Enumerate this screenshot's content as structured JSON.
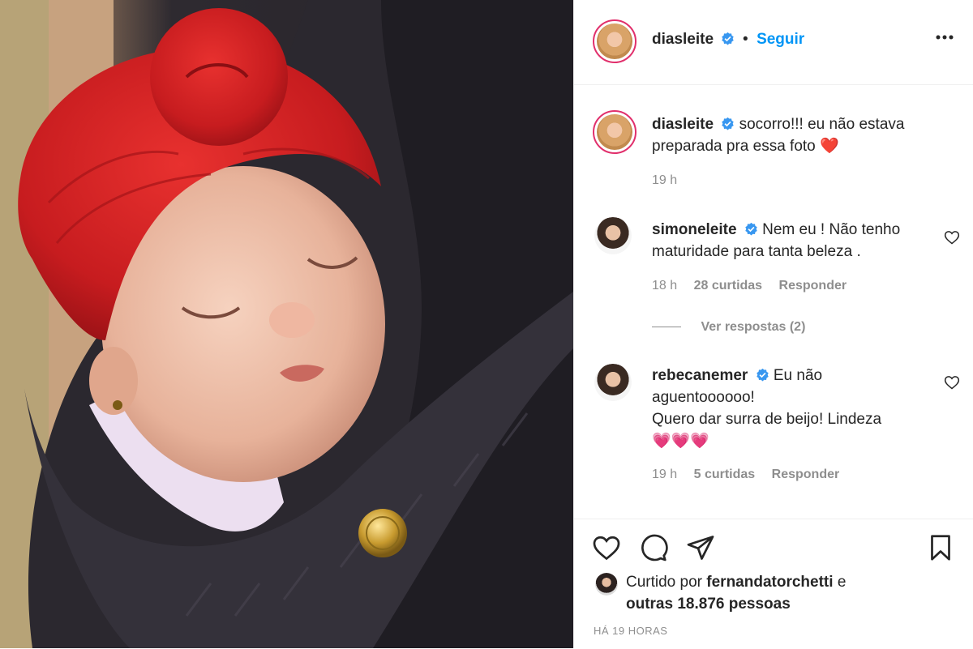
{
  "post": {
    "author": "diasleite",
    "follow_label": "Seguir",
    "dot": "•",
    "caption": "socorro!!! eu não estava preparada pra essa foto",
    "caption_emoji": "❤️",
    "caption_time": "19 h"
  },
  "comments": [
    {
      "user": "simoneleite",
      "text_line1": "Nem eu ! Não tenho",
      "text_line2": "maturidade para tanta beleza .",
      "time": "18 h",
      "likes": "28 curtidas",
      "reply": "Responder",
      "view_replies": "Ver respostas (2)"
    },
    {
      "user": "rebecanemer",
      "text_line1": "Eu não",
      "text_line2": "aguentoooooo!",
      "text_line3": "Quero dar surra de beijo! Lindeza",
      "emojis": "💗💗💗",
      "time": "19 h",
      "likes": "5 curtidas",
      "reply": "Responder"
    }
  ],
  "likes": {
    "prefix": "Curtido por",
    "user": "fernandatorchetti",
    "suffix": "e",
    "others": "outras 18.876 pessoas"
  },
  "timestamp": "HÁ 19 HORAS",
  "icons": {
    "more": "more-options-icon",
    "verified": "verified-badge-icon",
    "like": "heart-icon",
    "comment": "comment-icon",
    "share": "share-icon",
    "save": "bookmark-icon"
  },
  "colors": {
    "accent": "#0095f6",
    "verified": "#3897f0",
    "emoji_heart": "#e0245e"
  }
}
